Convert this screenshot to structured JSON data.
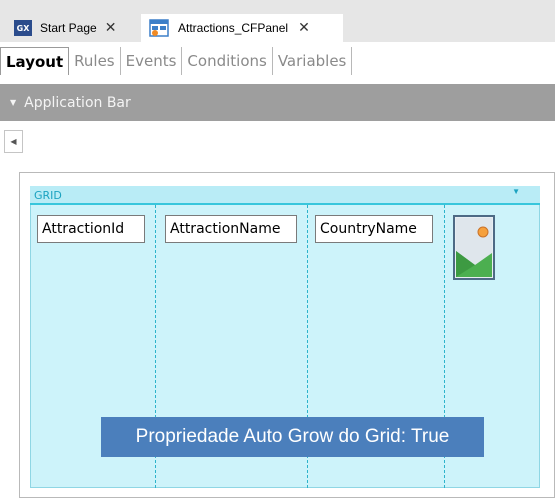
{
  "tabs": [
    {
      "label": "Start Page",
      "icon": "gx-logo-icon"
    },
    {
      "label": "Attractions_CFPanel",
      "icon": "panel-icon"
    }
  ],
  "gx_icon_text": "GX",
  "subtabs": [
    "Layout",
    "Rules",
    "Events",
    "Conditions",
    "Variables"
  ],
  "app_bar": {
    "label": "Application Bar"
  },
  "grid": {
    "title": "GRID",
    "columns": [
      "AttractionId",
      "AttractionName",
      "CountryName"
    ],
    "image_column_icon": "image-placeholder-icon"
  },
  "caption": "Propriedade Auto Grow do Grid: True",
  "colors": {
    "grid_bg": "#cdf3fa",
    "grid_accent": "#38c6dc",
    "caption_bg": "#4b7fbc",
    "app_bar_bg": "#9e9e9e"
  }
}
